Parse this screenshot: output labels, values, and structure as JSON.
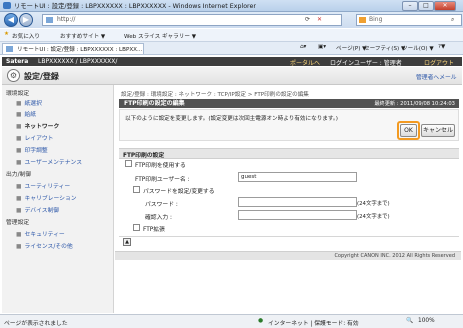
{
  "window": {
    "title": "リモートUI : 設定/登録 : LBPXXXXXX : LBPXXXXXX - Windows Internet Explorer",
    "address": "http://",
    "search_placeholder": "Bing",
    "favorites_label": "お気に入り",
    "suggested_sites": "おすすめサイト ▼",
    "web_slice": "Web スライス ギャラリー ▼",
    "tab_title": "リモートUI : 設定/登録 : LBPXXXXXX : LBPXX...",
    "toolbar_items": [
      "ページ(P) ▼",
      "セーフティ(S) ▼",
      "ツール(O) ▼",
      "?▼"
    ],
    "close_symbol": "✕"
  },
  "page": {
    "brand": "Satera",
    "device": "LBPXXXXXX / LBPXXXXXX/",
    "top_links": [
      "ポータルへ",
      "ログインユーザー : 管理者",
      "ログアウト"
    ],
    "header_title": "設定/登録",
    "header_link": "管理者へメール",
    "breadcrumb": "設定/登録 : 環境設定 : ネットワーク : TCP/IP設定 > FTP印刷の設定の編集",
    "panel_title": "FTP印刷の設定の編集",
    "last_updated": "最終更新 : 2011/09/08 10:24:03",
    "message": "以下のように設定を変更します。(設定変更は次回主電源オン時より有効になります。)",
    "ok_label": "OK",
    "cancel_label": "キャンセル",
    "section_title": "FTP印刷の設定",
    "use_ftp_label": "FTP印刷を使用する",
    "ftp_user_label": "FTP印刷ユーザー名 :",
    "ftp_user_value": "guest",
    "set_password_label": "パスワードを設定/変更する",
    "password_label": "パスワード :",
    "password_hint": "(24文字まで)",
    "confirm_label": "確認入力 :",
    "confirm_hint": "(24文字まで)",
    "ftp_extension_label": "FTP拡張",
    "copyright": "Copyright CANON INC. 2012 All Rights Reserved"
  },
  "sidebar": {
    "sections": [
      {
        "title": "環境設定",
        "items": [
          "紙選択",
          "給紙",
          "ネットワーク",
          "レイアウト",
          "印字調整",
          "ユーザーメンテナンス"
        ]
      },
      {
        "title": "出力/制御",
        "items": [
          "ユーティリティー",
          "キャリブレーション",
          "デバイス制御"
        ]
      },
      {
        "title": "管理設定",
        "items": [
          "セキュリティー",
          "ライセンス/その他"
        ]
      }
    ],
    "active_item": "ネットワーク"
  },
  "status": {
    "left": "ページが表示されました",
    "zone": "インターネット | 保護モード: 有効",
    "zoom": "100%"
  },
  "colors": {
    "highlight": "#f39a21",
    "link": "#2b56a8",
    "topbar": "#3d3d3d"
  }
}
